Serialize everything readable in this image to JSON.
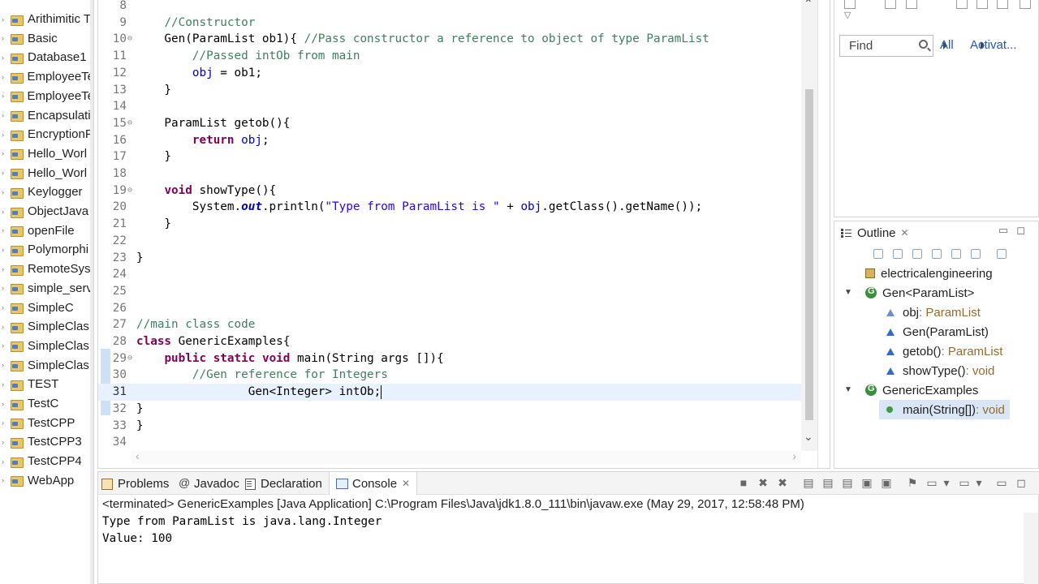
{
  "explorer": {
    "projects": [
      "Arithimitic T",
      "Basic",
      "Database1",
      "EmployeeTe",
      "EmployeeTe",
      "Encapsulati",
      "EncryptionP",
      "Hello_Worl",
      "Hello_Worl",
      "Keylogger",
      "ObjectJava",
      "openFile",
      "Polymorphi",
      "RemoteSyst",
      "simple_serv",
      "SimpleC",
      "SimpleClas",
      "SimpleClas",
      "SimpleClas",
      "TEST",
      "TestC",
      "TestCPP",
      "TestCPP3",
      "TestCPP4",
      "WebApp"
    ]
  },
  "editor": {
    "lines": [
      {
        "n": "8",
        "html": ""
      },
      {
        "n": "9",
        "html": "    <span class=\"cm\">//Constructor</span>"
      },
      {
        "n": "10",
        "html": "    Gen(ParamList ob1){ <span class=\"cm\">//Pass constructor a reference to object of type ParamList</span>"
      },
      {
        "n": "11",
        "html": "        <span class=\"cm\">//Passed intOb from main</span>"
      },
      {
        "n": "12",
        "html": "        <span class=\"fld\">obj</span> = ob1;"
      },
      {
        "n": "13",
        "html": "    }"
      },
      {
        "n": "14",
        "html": ""
      },
      {
        "n": "15",
        "html": "    ParamList getob(){"
      },
      {
        "n": "16",
        "html": "        <span class=\"kw\">return</span> <span class=\"fld\">obj</span>;"
      },
      {
        "n": "17",
        "html": "    }"
      },
      {
        "n": "18",
        "html": ""
      },
      {
        "n": "19",
        "html": "    <span class=\"kw\">void</span> showType(){"
      },
      {
        "n": "20",
        "html": "        System.<span class=\"sfld\">out</span>.println(<span class=\"st\">\"Type from ParamList is \"</span> + <span class=\"fld\">obj</span>.getClass().getName());"
      },
      {
        "n": "21",
        "html": "    }"
      },
      {
        "n": "22",
        "html": ""
      },
      {
        "n": "23",
        "html": "}"
      },
      {
        "n": "24",
        "html": ""
      },
      {
        "n": "25",
        "html": ""
      },
      {
        "n": "26",
        "html": ""
      },
      {
        "n": "27",
        "html": "<span class=\"cm\">//main class code</span>"
      },
      {
        "n": "28",
        "html": "<span class=\"kw\">class</span> GenericExamples{"
      },
      {
        "n": "29",
        "html": "    <span class=\"kw\">public</span> <span class=\"kw\">static</span> <span class=\"kw\">void</span> main(String args []){"
      },
      {
        "n": "30",
        "html": "        <span class=\"cm\">//Gen reference for Integers</span>"
      },
      {
        "n": "31",
        "html": "                Gen&lt;Integer&gt; intOb;<span class=\"caret\"></span>"
      },
      {
        "n": "32",
        "html": "}"
      },
      {
        "n": "33",
        "html": "}"
      },
      {
        "n": "34",
        "html": ""
      }
    ],
    "current_line": "31",
    "fold_lines": [
      "10",
      "15",
      "19",
      "29"
    ]
  },
  "tasklist": {
    "find_placeholder": "Find",
    "all_label": "All",
    "activate_label": "Activat..."
  },
  "outline": {
    "tab_label": "Outline",
    "items": [
      {
        "label": "electricalengineering",
        "type": "",
        "kind": "package"
      },
      {
        "label": "Gen<ParamList>",
        "type": "",
        "kind": "class"
      },
      {
        "label": "obj",
        "type": " : ParamList",
        "kind": "field"
      },
      {
        "label": "Gen(ParamList)",
        "type": "",
        "kind": "constructor"
      },
      {
        "label": "getob()",
        "type": " : ParamList",
        "kind": "method"
      },
      {
        "label": "showType()",
        "type": " : void",
        "kind": "method"
      },
      {
        "label": "GenericExamples",
        "type": "",
        "kind": "class"
      },
      {
        "label": "main(String[])",
        "type": " : void",
        "kind": "static-method"
      }
    ]
  },
  "console": {
    "tabs": [
      "Problems",
      "Javadoc",
      "Declaration",
      "Console"
    ],
    "header": "<terminated> GenericExamples [Java Application] C:\\Program Files\\Java\\jdk1.8.0_111\\bin\\javaw.exe (May 29, 2017, 12:58:48 PM)",
    "output": [
      "Type from ParamList is java.lang.Integer",
      "Value: 100"
    ]
  },
  "colors": {
    "keyword": "#7f0055",
    "comment": "#3f7f5f",
    "string": "#2a00ff",
    "field": "#0000c0",
    "link": "#2458b8"
  }
}
